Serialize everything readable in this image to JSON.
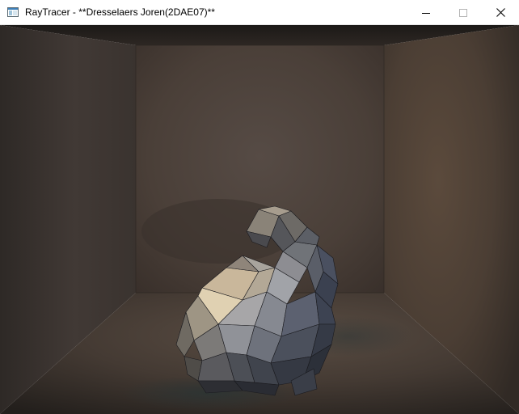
{
  "window": {
    "title": "RayTracer - **Dresselaers Joren(2DAE07)**",
    "icon": "app-window-icon"
  },
  "controls": {
    "minimize_icon": "minimize-icon",
    "maximize_icon": "maximize-icon",
    "close_icon": "close-icon"
  },
  "scene": {
    "subject": "low-poly-bunny-in-cornell-box"
  }
}
